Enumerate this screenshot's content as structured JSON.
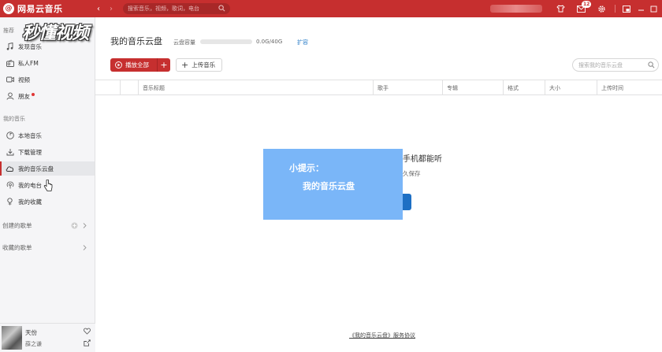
{
  "app": {
    "name": "网易云音乐",
    "logo_glyph": "@"
  },
  "titlebar": {
    "back_glyph": "‹",
    "forward_glyph": "›",
    "search_placeholder": "搜索音乐，视频，歌词，电台",
    "message_badge": "12"
  },
  "watermark": "秒懂视频",
  "sidebar": {
    "section_recommend": "推荐",
    "recommend_items": [
      {
        "label": "发现音乐",
        "icon": "music-note-icon"
      },
      {
        "label": "私人FM",
        "icon": "radio-icon"
      },
      {
        "label": "视频",
        "icon": "video-icon"
      },
      {
        "label": "朋友",
        "icon": "friends-icon"
      }
    ],
    "section_my_music": "我的音乐",
    "my_music_items": [
      {
        "label": "本地音乐",
        "icon": "local-music-icon"
      },
      {
        "label": "下载管理",
        "icon": "download-icon"
      },
      {
        "label": "我的音乐云盘",
        "icon": "cloud-icon"
      },
      {
        "label": "我的电台",
        "icon": "podcast-icon"
      },
      {
        "label": "我的收藏",
        "icon": "collection-icon"
      }
    ],
    "created_playlists": "创建的歌单",
    "collected_playlists": "收藏的歌单"
  },
  "player": {
    "song": "天份",
    "artist": "薛之谦"
  },
  "main": {
    "title": "我的音乐云盘",
    "capacity_label": "云盘容量",
    "capacity_value": "0.0G/40G",
    "expand_label": "扩容",
    "play_all_label": "播放全部",
    "add_glyph": "+",
    "upload_label": "上传音乐",
    "search_placeholder": "搜索我的音乐云盘",
    "columns": [
      "音乐标题",
      "歌手",
      "专辑",
      "格式",
      "大小",
      "上传时间"
    ],
    "empty_title_fragment": "手机都能听",
    "empty_sub_fragment": "久保存",
    "footer_link": "《我的音乐云盘》服务协议"
  },
  "tooltip": {
    "title": "小提示：",
    "body": "我的音乐云盘"
  },
  "colors": {
    "brand_red": "#c62f2f",
    "tooltip_blue": "#7ab6f8",
    "link_blue": "#2a7dc7"
  }
}
